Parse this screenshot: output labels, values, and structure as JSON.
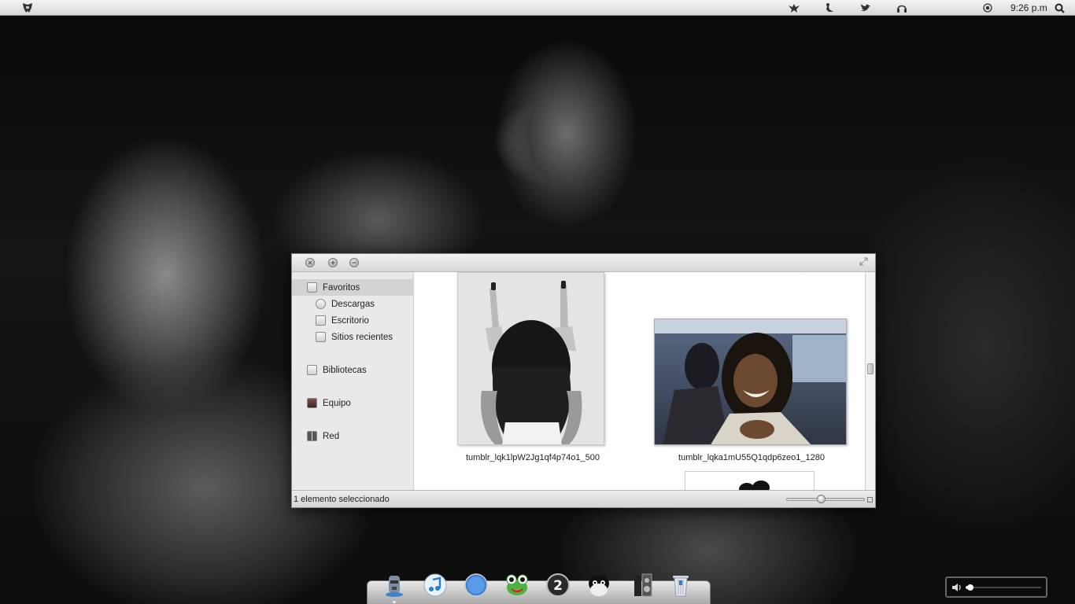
{
  "top_panel": {
    "clock": "9:26 p.m",
    "tray_icons": [
      "transformers-logo-icon",
      "creature-icon",
      "mermaid-icon",
      "twitter-bird-icon",
      "headphones-icon",
      "record-icon",
      "search-icon"
    ]
  },
  "window": {
    "title_buttons": [
      "close",
      "maximize",
      "minimize"
    ],
    "sidebar": {
      "sections": [
        {
          "label": "Favoritos",
          "icon": "star-icon",
          "selected": true
        },
        {
          "label": "Descargas",
          "icon": "download-icon"
        },
        {
          "label": "Escritorio",
          "icon": "desktop-icon"
        },
        {
          "label": "Sitios recientes",
          "icon": "recent-icon"
        },
        {
          "label": "Bibliotecas",
          "icon": "library-icon"
        },
        {
          "label": "Equipo",
          "icon": "computer-icon"
        },
        {
          "label": "Red",
          "icon": "network-icon"
        }
      ]
    },
    "files": [
      {
        "name": "tumblr_lqk1lpW2Jg1qf4p74o1_500"
      },
      {
        "name": "tumblr_lqka1mU55Q1qdp6zeo1_1280"
      }
    ],
    "status": "1 elemento seleccionado",
    "zoom_level": 0.44
  },
  "dock": {
    "items": [
      "moai-icon",
      "itunes-icon",
      "safari-icon",
      "frog-icon",
      "badge-2-icon",
      "mascot-icon",
      "speaker-icon",
      "trash-icon"
    ]
  },
  "volume": {
    "level": 0.05
  }
}
